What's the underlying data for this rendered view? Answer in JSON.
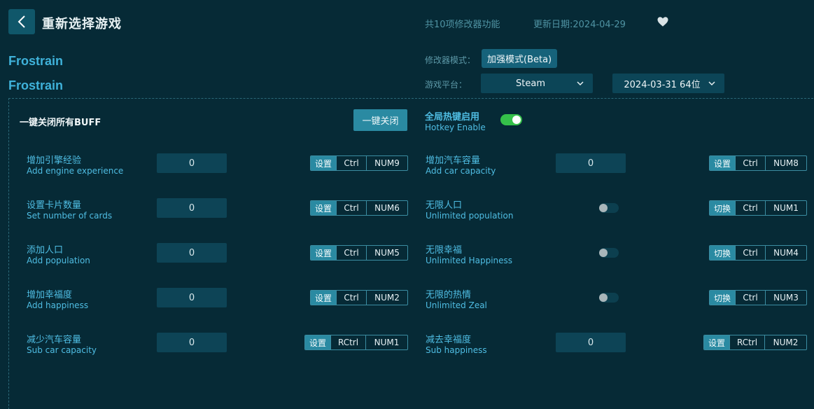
{
  "header": {
    "title": "重新选择游戏",
    "feature_count": "共10项修改器功能",
    "update_date": "更新日期:2024-04-29"
  },
  "game": {
    "name_1": "Frostrain",
    "name_2": "Frostrain"
  },
  "settings": {
    "mode_label": "修改器模式：",
    "mode_value": "加强模式(Beta)",
    "platform_label": "游戏平台：",
    "platform_value": "Steam",
    "version_value": "2024-03-31 64位"
  },
  "global": {
    "buff_label": "一键关闭所有BUFF",
    "close_all_label": "一键关闭",
    "hotkey_cn": "全局热键启用",
    "hotkey_en": "Hotkey Enable",
    "hotkey_enabled": true
  },
  "options_left": [
    {
      "cn": "增加引擎经验",
      "en": "Add engine experience",
      "value": "0",
      "action": "设置",
      "mod": "Ctrl",
      "key": "NUM9"
    },
    {
      "cn": "设置卡片数量",
      "en": "Set number of cards",
      "value": "0",
      "action": "设置",
      "mod": "Ctrl",
      "key": "NUM6"
    },
    {
      "cn": "添加人口",
      "en": "Add population",
      "value": "0",
      "action": "设置",
      "mod": "Ctrl",
      "key": "NUM5"
    },
    {
      "cn": "增加幸福度",
      "en": "Add happiness",
      "value": "0",
      "action": "设置",
      "mod": "Ctrl",
      "key": "NUM2"
    },
    {
      "cn": "减少汽车容量",
      "en": "Sub car capacity",
      "value": "0",
      "action": "设置",
      "mod": "RCtrl",
      "key": "NUM1"
    }
  ],
  "options_right": [
    {
      "cn": "增加汽车容量",
      "en": "Add car capacity",
      "value": "0",
      "action": "设置",
      "mod": "Ctrl",
      "key": "NUM8"
    },
    {
      "cn": "无限人口",
      "en": "Unlimited population",
      "action": "切换",
      "mod": "Ctrl",
      "key": "NUM1",
      "enabled": false
    },
    {
      "cn": "无限幸福",
      "en": "Unlimited Happiness",
      "action": "切换",
      "mod": "Ctrl",
      "key": "NUM4",
      "enabled": false
    },
    {
      "cn": "无限的热情",
      "en": "Unlimited Zeal",
      "action": "切换",
      "mod": "Ctrl",
      "key": "NUM3",
      "enabled": false
    },
    {
      "cn": "减去幸福度",
      "en": "Sub happiness",
      "value": "0",
      "action": "设置",
      "mod": "RCtrl",
      "key": "NUM2"
    }
  ]
}
